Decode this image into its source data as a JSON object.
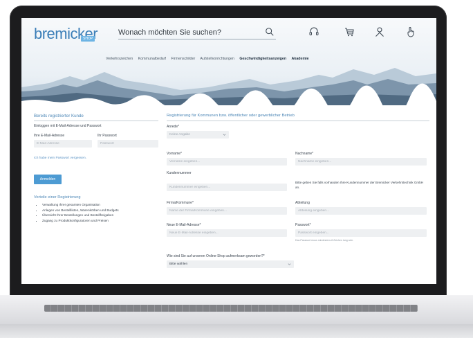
{
  "header": {
    "logo_text": "bremicker",
    "logo_sub": "SHOP",
    "search_placeholder": "Wonach möchten Sie suchen?"
  },
  "nav": {
    "items": [
      "Verkehrszeichen",
      "Kommunalbedarf",
      "Firmenschilder",
      "Aufstellvorrichtungen",
      "Geschwindigkeitsanzeigen",
      "Akademie"
    ]
  },
  "login": {
    "title": "Bereits registrierter Kunde",
    "intro": "Einloggen mit E-Mail-Adresse und Passwort",
    "email_label": "Ihre E-Mail-Adresse",
    "password_label": "Ihr Passwort",
    "email_placeholder": "E-Mail-Adresse",
    "password_placeholder": "Passwort",
    "forgot_link": "Ich habe mein Passwort vergessen.",
    "submit_label": "Anmelden",
    "benefits_title": "Vorteile einer Registrierung",
    "benefits": [
      "Verwaltung Ihrer gesamten Organisation",
      "Anlegen von Bestelllisten, Warenkörben und Budgets",
      "Übersicht Ihrer Bestellungen und Bestellfreigaben",
      "Zugang zu Produktkonfiguratoren und Preisen"
    ]
  },
  "register": {
    "title": "Registrierung für Kommunen bzw. öffentlicher oder gewerblicher Betrieb",
    "salutation_label": "Anrede*",
    "salutation_value": "Keine Angabe",
    "firstname_label": "Vorname*",
    "firstname_placeholder": "Vorname eingeben...",
    "lastname_label": "Nachname*",
    "lastname_placeholder": "Nachname eingeben...",
    "customer_no_label": "Kundennummer",
    "customer_no_placeholder": "Kundennummer eingeben...",
    "customer_no_hint": "Bitte geben Sie falls vorhanden Ihre Kundennummer der Bremicker Verkehrstechnik GmbH an.",
    "company_label": "Firma/Kommune*",
    "company_placeholder": "Name der Firma/Kommune eingeben...",
    "department_label": "Abteilung",
    "department_placeholder": "Abteilung eingeben...",
    "email_label": "Neue E-Mail-Adresse*",
    "email_placeholder": "Neue E-Mail-Adresse eingeben...",
    "password_label": "Passwort*",
    "password_placeholder": "Passwort eingeben...",
    "password_hint": "Das Passwort muss mindestens 8 Zeichen lang sein.",
    "source_label": "Wie sind Sie auf unseren Online-Shop aufmerksam geworden?*",
    "source_value": "Bitte wählen"
  }
}
